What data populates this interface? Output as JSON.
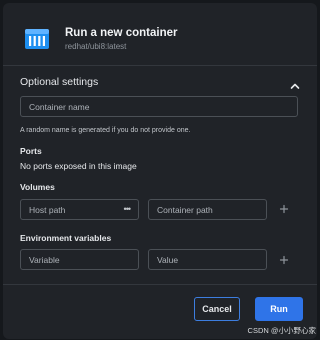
{
  "dialog": {
    "title": "Run a new container",
    "image": "redhat/ubi8:latest",
    "icon": "container-icon"
  },
  "optional_settings": {
    "title": "Optional settings",
    "expanded": true,
    "toggle_icon": "chevron-up-icon"
  },
  "container_name": {
    "placeholder": "Container name",
    "value": "",
    "help": "A random name is generated if you do not provide one."
  },
  "ports": {
    "label": "Ports",
    "empty_text": "No ports exposed in this image"
  },
  "volumes": {
    "label": "Volumes",
    "host_path_placeholder": "Host path",
    "browse_label": "•••",
    "container_path_placeholder": "Container path",
    "add_icon": "plus-icon"
  },
  "env": {
    "label": "Environment variables",
    "variable_placeholder": "Variable",
    "value_placeholder": "Value",
    "add_icon": "plus-icon"
  },
  "actions": {
    "cancel_label": "Cancel",
    "run_label": "Run"
  },
  "watermark": "CSDN @小小野心家",
  "colors": {
    "background": "#202328",
    "accent": "#2f74e8",
    "border": "#4b5056"
  }
}
